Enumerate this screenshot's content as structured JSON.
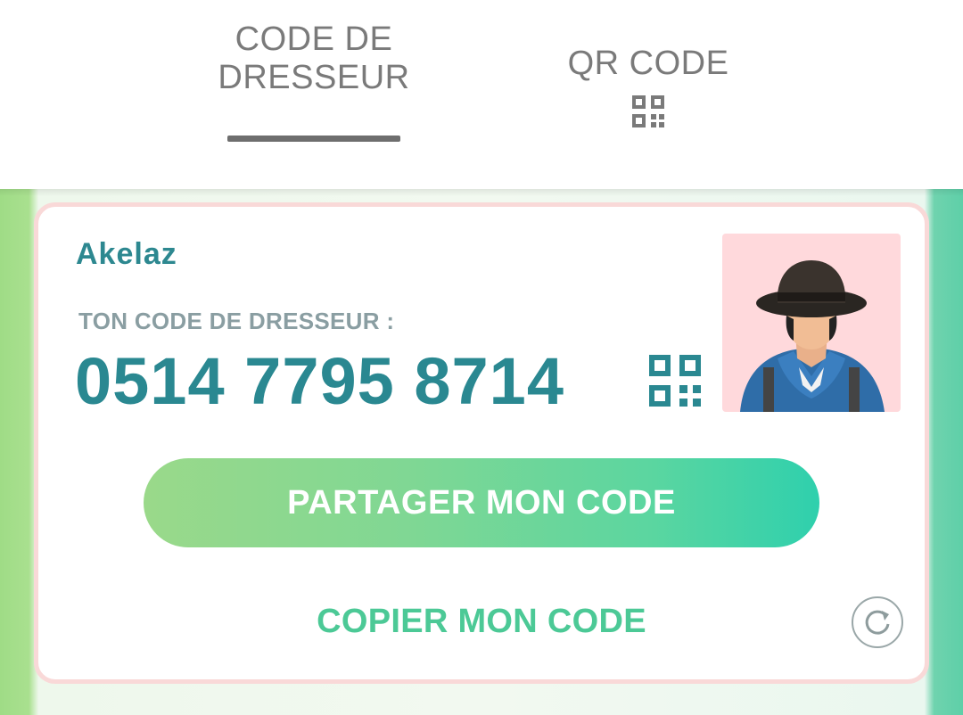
{
  "tabs": {
    "trainer_code": "CODE DE\nDRESSEUR",
    "qr_code": "QR CODE"
  },
  "card": {
    "trainer_name": "Akelaz",
    "code_label": "TON CODE DE DRESSEUR :",
    "code_value": "0514 7795 8714",
    "share_button": "PARTAGER MON CODE",
    "copy_link": "COPIER MON CODE"
  },
  "icons": {
    "qr_mini": "qr-code-icon",
    "qr_big": "qr-code-icon",
    "refresh": "refresh-icon",
    "avatar": "trainer-avatar"
  },
  "colors": {
    "accent_teal": "#2a8891",
    "accent_green": "#4cc996",
    "card_border": "#f9d9d8",
    "avatar_bg": "#ffd9dc"
  }
}
